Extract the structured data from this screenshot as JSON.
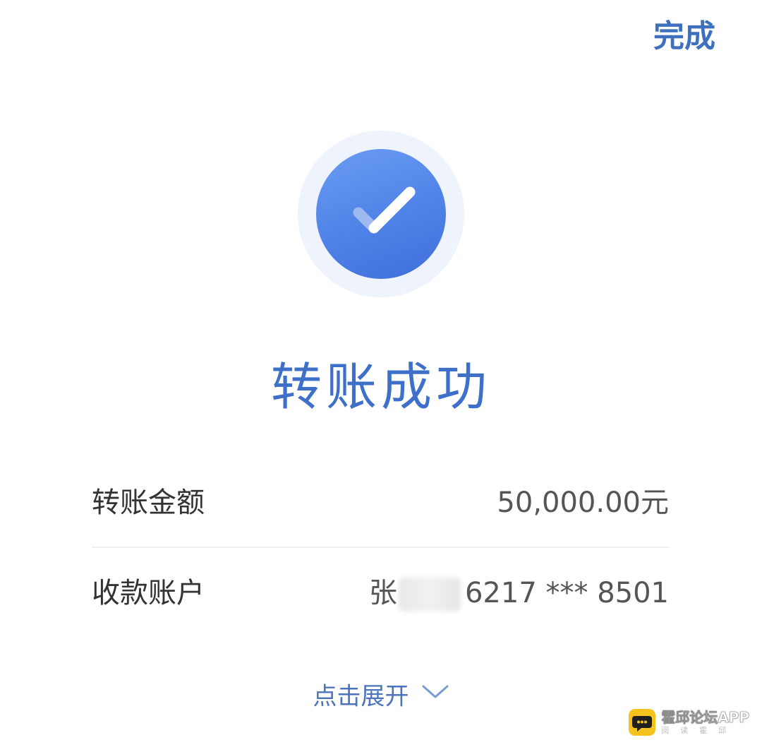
{
  "header": {
    "done_label": "完成"
  },
  "status": {
    "icon": "check-circle-icon",
    "title": "转账成功",
    "accent_color": "#3f70c9"
  },
  "details": {
    "amount": {
      "label": "转账金额",
      "value": "50,000.00元"
    },
    "payee": {
      "label": "收款账户",
      "name_prefix": "张",
      "account": "6217 *** 8501"
    }
  },
  "expand": {
    "label": "点击展开",
    "icon": "chevron-down-icon"
  },
  "watermark": {
    "name": "霍邱论坛APP",
    "sub": "阅读霍邱"
  }
}
